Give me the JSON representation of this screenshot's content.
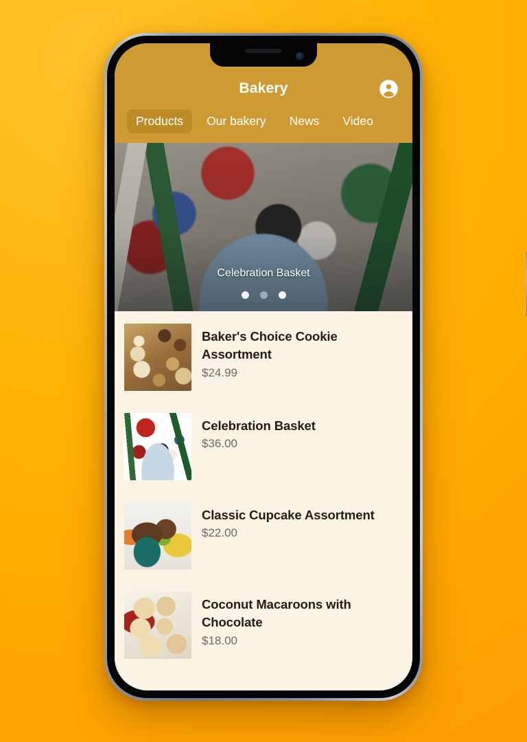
{
  "theme": {
    "page_background": "#FFAC00",
    "header_gold": "#CE9B32",
    "active_tab_gold": "#BE8C26",
    "list_background": "#FBF3E3",
    "title_text": "#241C10",
    "price_text": "#6E6A63"
  },
  "app": {
    "title": "Bakery",
    "avatar_icon": "account-circle-icon"
  },
  "tabs": [
    {
      "label": "Products",
      "active": true
    },
    {
      "label": "Our bakery",
      "active": false
    },
    {
      "label": "News",
      "active": false
    },
    {
      "label": "Video",
      "active": false
    }
  ],
  "carousel": {
    "caption": "Celebration Basket",
    "slides": 3,
    "active_index": 2,
    "dots": [
      "inactive",
      "inactive",
      "active"
    ]
  },
  "products": [
    {
      "name": "Baker's Choice Cookie Assortment",
      "price": "$24.99",
      "thumb": "cookie-assortment-thumb"
    },
    {
      "name": "Celebration Basket",
      "price": "$36.00",
      "thumb": "celebration-basket-thumb"
    },
    {
      "name": "Classic Cupcake Assortment",
      "price": "$22.00",
      "thumb": "cupcake-assortment-thumb"
    },
    {
      "name": "Coconut Macaroons with Chocolate",
      "price": "$18.00",
      "thumb": "coconut-macaroon-thumb"
    }
  ]
}
